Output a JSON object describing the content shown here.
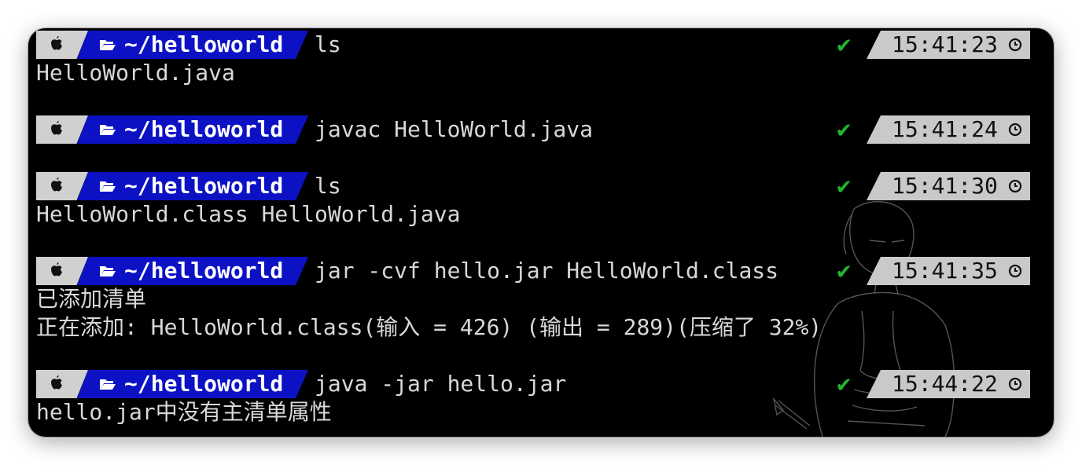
{
  "terminal": {
    "prompt_path": "~/helloworld",
    "blocks": [
      {
        "command": "ls",
        "time": "15:41:23",
        "status": "success",
        "output": [
          "HelloWorld.java"
        ]
      },
      {
        "command": "javac HelloWorld.java",
        "time": "15:41:24",
        "status": "success",
        "output": []
      },
      {
        "command": "ls",
        "time": "15:41:30",
        "status": "success",
        "output": [
          "HelloWorld.class HelloWorld.java"
        ]
      },
      {
        "command": "jar -cvf hello.jar HelloWorld.class",
        "time": "15:41:35",
        "status": "success",
        "output": [
          "已添加清单",
          "正在添加: HelloWorld.class(输入 = 426) (输出 = 289)(压缩了 32%)"
        ]
      },
      {
        "command": "java -jar hello.jar",
        "time": "15:44:22",
        "status": "success",
        "output": [
          "hello.jar中没有主清单属性"
        ]
      }
    ],
    "status_symbol": "✔",
    "colors": {
      "background": "#000000",
      "text": "#d8d8d8",
      "os_segment": "#d0d0d0",
      "path_segment": "#0c12c4",
      "time_segment": "#c9c9c9",
      "success": "#21b531"
    },
    "icons": {
      "os": "apple-icon",
      "path": "folder-open-icon",
      "time": "clock-icon"
    }
  }
}
